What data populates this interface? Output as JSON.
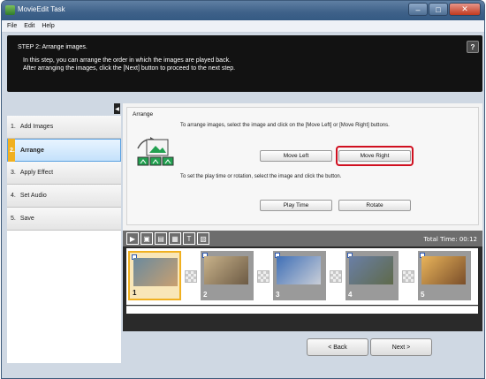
{
  "window": {
    "title": "MovieEdit Task"
  },
  "menu": [
    "File",
    "Edit",
    "Help"
  ],
  "banner": {
    "step_title": "STEP 2: Arrange images.",
    "line1": "In this step, you can arrange the order in which the images are played back.",
    "line2": "After arranging the images, click the [Next] button to proceed to the next step.",
    "help_label": "?"
  },
  "nav": {
    "items": [
      {
        "num": "1.",
        "label": "Add Images"
      },
      {
        "num": "2.",
        "label": "Arrange"
      },
      {
        "num": "3.",
        "label": "Apply Effect"
      },
      {
        "num": "4.",
        "label": "Set Audio"
      },
      {
        "num": "5.",
        "label": "Save"
      }
    ],
    "active_index": 1
  },
  "arrange": {
    "label": "Arrange",
    "desc1": "To arrange images, select the image and click on the [Move Left] or [Move Right] buttons.",
    "desc2": "To set the play time or rotation, select the image and click the button.",
    "move_left": "Move Left",
    "move_right": "Move Right",
    "play_time": "Play Time",
    "rotate": "Rotate"
  },
  "timeline": {
    "total_time": "Total Time: 00:12",
    "tool_icons": [
      "play-icon",
      "photo-icon",
      "photo-add-icon",
      "photo-frame-icon",
      "text-icon",
      "delete-icon"
    ],
    "clips": [
      {
        "index": "1",
        "selected": true,
        "colors": [
          "#6a8a9e",
          "#c9a070"
        ]
      },
      {
        "index": "2",
        "selected": false,
        "colors": [
          "#c8b28a",
          "#6c5a44"
        ]
      },
      {
        "index": "3",
        "selected": false,
        "colors": [
          "#3f6fb6",
          "#c9ced8"
        ]
      },
      {
        "index": "4",
        "selected": false,
        "colors": [
          "#6a7fa6",
          "#5f6a4a"
        ]
      },
      {
        "index": "5",
        "selected": false,
        "colors": [
          "#e9b45a",
          "#7a4e2a"
        ]
      }
    ]
  },
  "footer": {
    "back": "< Back",
    "next": "Next >"
  },
  "colors": {
    "highlight": "#d01020",
    "active_nav": "#c4e1fb",
    "banner": "#121212"
  }
}
